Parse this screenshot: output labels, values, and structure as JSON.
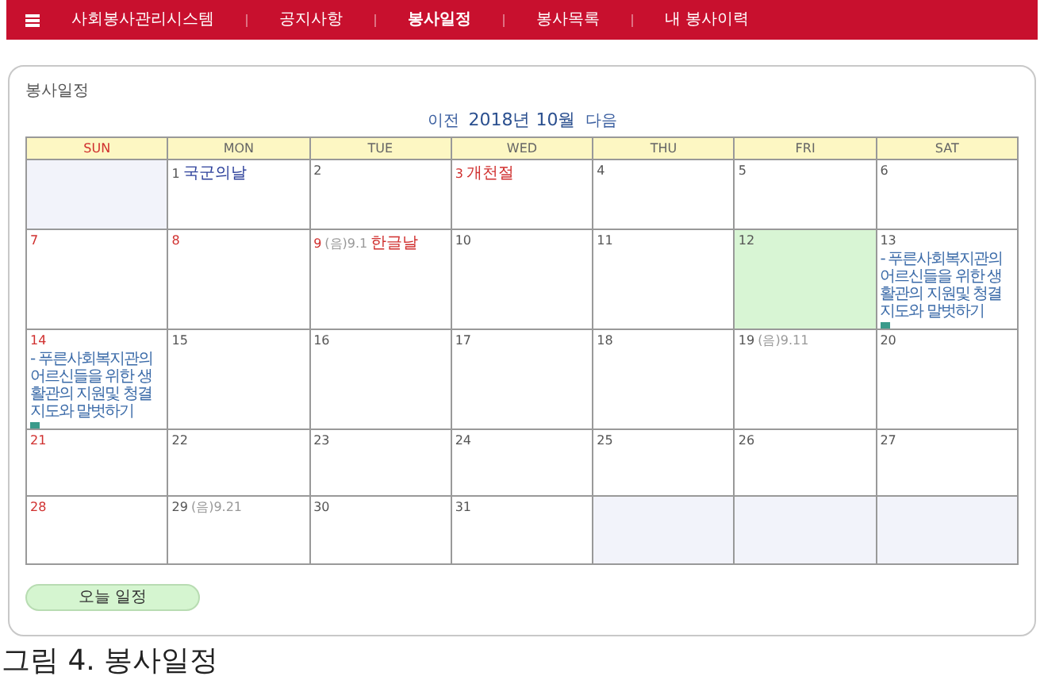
{
  "nav": {
    "items": [
      {
        "label": "사회봉사관리시스템",
        "selected": false
      },
      {
        "label": "공지사항",
        "selected": false
      },
      {
        "label": "봉사일정",
        "selected": true
      },
      {
        "label": "봉사목록",
        "selected": false
      },
      {
        "label": "내 봉사이력",
        "selected": false
      }
    ]
  },
  "panel": {
    "title": "봉사일정",
    "prev": "이전",
    "month": "2018년 10월",
    "next": "다음"
  },
  "weekdays": [
    {
      "label": "SUN",
      "weekend": true
    },
    {
      "label": "MON",
      "weekend": false
    },
    {
      "label": "TUE",
      "weekend": false
    },
    {
      "label": "WED",
      "weekend": false
    },
    {
      "label": "THU",
      "weekend": false
    },
    {
      "label": "FRI",
      "weekend": false
    },
    {
      "label": "SAT",
      "weekend": false
    }
  ],
  "weeks": [
    [
      {
        "kind": "empty"
      },
      {
        "kind": "day",
        "day": "1",
        "red": false,
        "today": false,
        "note": "국군의날",
        "holiday": false
      },
      {
        "kind": "day",
        "day": "2",
        "red": false,
        "today": false
      },
      {
        "kind": "day",
        "day": "3",
        "red": true,
        "today": false,
        "note": "개천절",
        "holiday": true
      },
      {
        "kind": "day",
        "day": "4",
        "red": false,
        "today": false
      },
      {
        "kind": "day",
        "day": "5",
        "red": false,
        "today": false
      },
      {
        "kind": "day",
        "day": "6",
        "red": false,
        "today": false
      }
    ],
    [
      {
        "kind": "day",
        "day": "7",
        "red": true,
        "today": false
      },
      {
        "kind": "day",
        "day": "8",
        "red": true,
        "today": false
      },
      {
        "kind": "day",
        "day": "9",
        "red": true,
        "today": false,
        "lunar": "(음)9.1",
        "note": "한글날",
        "holiday": true
      },
      {
        "kind": "day",
        "day": "10",
        "red": false,
        "today": false
      },
      {
        "kind": "day",
        "day": "11",
        "red": false,
        "today": false
      },
      {
        "kind": "day",
        "day": "12",
        "red": false,
        "today": true
      },
      {
        "kind": "day",
        "day": "13",
        "red": false,
        "today": false,
        "event": "- 푸른사회복지관의 어르신들을 위한 생활관의 지원및 청결지도와 말벗하기"
      }
    ],
    [
      {
        "kind": "day",
        "day": "14",
        "red": true,
        "today": false,
        "event": "- 푸른사회복지관의 어르신들을 위한 생활관의 지원및 청결지도와 말벗하기"
      },
      {
        "kind": "day",
        "day": "15",
        "red": false,
        "today": false
      },
      {
        "kind": "day",
        "day": "16",
        "red": false,
        "today": false
      },
      {
        "kind": "day",
        "day": "17",
        "red": false,
        "today": false
      },
      {
        "kind": "day",
        "day": "18",
        "red": false,
        "today": false
      },
      {
        "kind": "day",
        "day": "19",
        "red": false,
        "today": false,
        "lunar": "(음)9.11"
      },
      {
        "kind": "day",
        "day": "20",
        "red": false,
        "today": false
      }
    ],
    [
      {
        "kind": "day",
        "day": "21",
        "red": true,
        "today": false
      },
      {
        "kind": "day",
        "day": "22",
        "red": false,
        "today": false
      },
      {
        "kind": "day",
        "day": "23",
        "red": false,
        "today": false
      },
      {
        "kind": "day",
        "day": "24",
        "red": false,
        "today": false
      },
      {
        "kind": "day",
        "day": "25",
        "red": false,
        "today": false
      },
      {
        "kind": "day",
        "day": "26",
        "red": false,
        "today": false
      },
      {
        "kind": "day",
        "day": "27",
        "red": false,
        "today": false
      }
    ],
    [
      {
        "kind": "day",
        "day": "28",
        "red": true,
        "today": false
      },
      {
        "kind": "day",
        "day": "29",
        "red": false,
        "today": false,
        "lunar": "(음)9.21"
      },
      {
        "kind": "day",
        "day": "30",
        "red": false,
        "today": false
      },
      {
        "kind": "day",
        "day": "31",
        "red": false,
        "today": false
      },
      {
        "kind": "empty"
      },
      {
        "kind": "empty"
      },
      {
        "kind": "empty"
      }
    ]
  ],
  "today_button": "오늘 일정",
  "caption": "그림 4. 봉사일정"
}
